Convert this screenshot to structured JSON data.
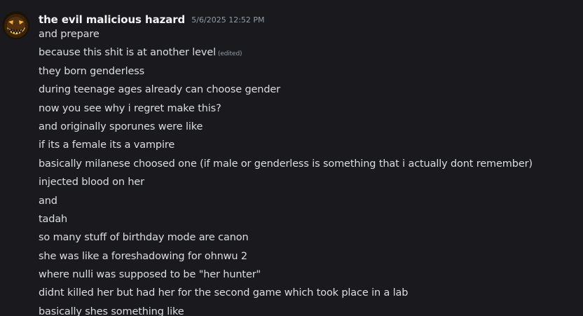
{
  "message": {
    "author": "the evil malicious hazard",
    "timestamp": "5/6/2025 12:52 PM",
    "avatar_icon": "jack-o-lantern-avatar",
    "edited_label": "(edited)",
    "lines": [
      "and prepare",
      "because this shit is at another level",
      "they born genderless",
      "during teenage ages already can choose gender",
      "now you see why i regret make this?",
      "and originally sporunes were like",
      "if its a female its a vampire",
      "basically milanese choosed one (if male or genderless is something that i actually dont remember)",
      "injected blood on her",
      "and",
      "tadah",
      "so many stuff of birthday mode are canon",
      "she was like a foreshadowing for ohnwu 2",
      "where nulli was supposed to be \"her hunter\"",
      "didnt killed her but had her for the second game which took place in a lab",
      "basically shes something like"
    ]
  },
  "colors": {
    "background": "#1a1a1e",
    "username": "#f2f3f5",
    "text": "#dbdee1",
    "muted": "#949ba4"
  }
}
